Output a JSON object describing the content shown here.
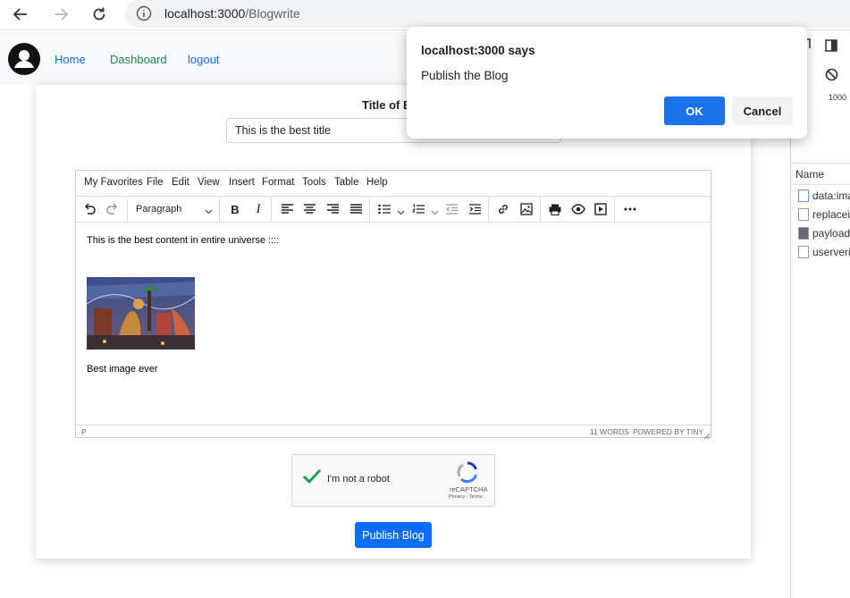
{
  "browser": {
    "url_host": "localhost:3000",
    "url_path": "/Blogwrite"
  },
  "nav": {
    "home": "Home",
    "dashboard": "Dashboard",
    "logout": "logout"
  },
  "form": {
    "title_label": "Title of B",
    "title_value": "This is the best title",
    "publish_label": "Publish Blog"
  },
  "editor": {
    "menus": [
      "My Favorites",
      "File",
      "Edit",
      "View",
      "Insert",
      "Format",
      "Tools",
      "Table",
      "Help"
    ],
    "block_format": "Paragraph",
    "content_line1": "This is the best content in entire universe ::::",
    "content_line2": "Best image  ever",
    "status_path": "P",
    "status_words": "11 WORDS",
    "status_powered": "POWERED BY TINY"
  },
  "captcha": {
    "label": "I'm not a robot",
    "brand": "reCAPTCHA",
    "links": "Privacy - Terms"
  },
  "dialog": {
    "title": "localhost:3000 says",
    "message": "Publish the Blog",
    "ok": "OK",
    "cancel": "Cancel"
  },
  "devtools": {
    "size_label": "1000",
    "column_header": "Name",
    "rows": [
      "data:ima",
      "replacei",
      "payload",
      "userveri"
    ]
  },
  "colors": {
    "nav_home": "#0d6efd",
    "nav_dashboard": "#198754",
    "publish_button": "#0d6efd",
    "dialog_ok": "#1a73e8"
  }
}
